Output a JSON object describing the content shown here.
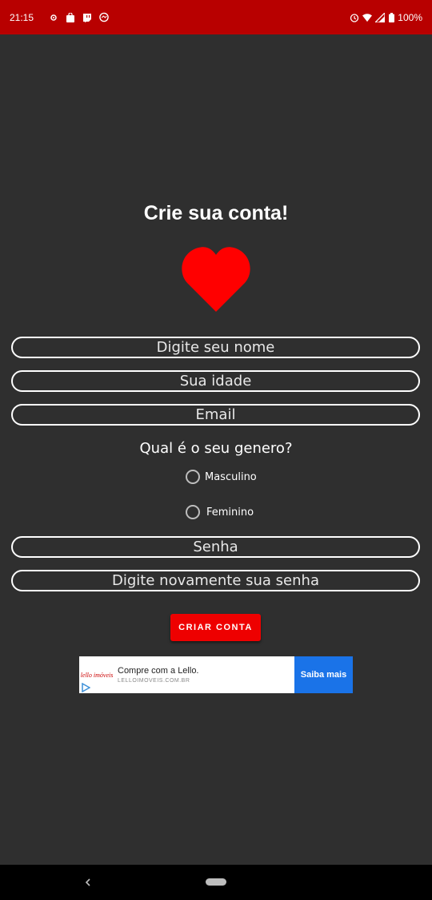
{
  "status_bar": {
    "time": "21:15",
    "battery": "100%",
    "icons": [
      "settings-notif-icon",
      "shopping-bag-icon",
      "twitch-icon",
      "chat-bubble-icon",
      "alarm-icon",
      "wifi-icon",
      "signal-icon",
      "battery-icon"
    ]
  },
  "form": {
    "title": "Crie sua conta!",
    "name_placeholder": "Digite seu nome",
    "age_placeholder": "Sua idade",
    "email_placeholder": "Email",
    "gender_question": "Qual é o seu genero?",
    "gender_options": [
      {
        "label": "Masculino",
        "selected": false
      },
      {
        "label": "Feminino",
        "selected": false
      }
    ],
    "password_placeholder": "Senha",
    "password_confirm_placeholder": "Digite novamente sua senha",
    "submit_label": "CRIAR CONTA"
  },
  "ad": {
    "logo_text": "lello imóveis",
    "headline": "Compre com a Lello.",
    "url": "LELLOIMOVEIS.COM.BR",
    "cta": "Saiba mais"
  },
  "colors": {
    "status_bar": "#b80000",
    "background": "#2f2f2f",
    "accent": "#ee0000",
    "heart": "#ff0000",
    "ad_cta": "#1a73e8"
  }
}
